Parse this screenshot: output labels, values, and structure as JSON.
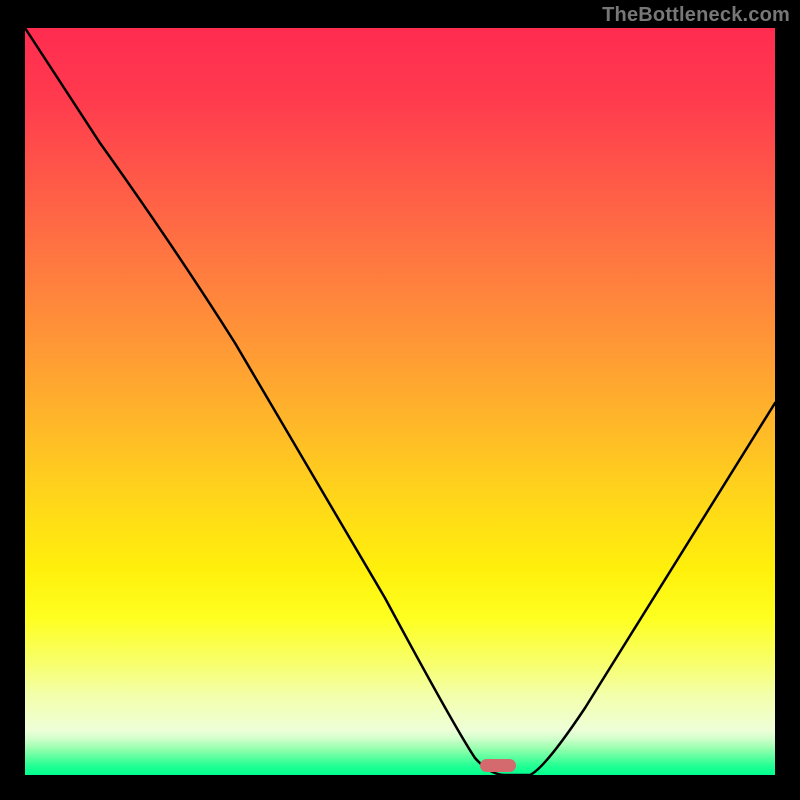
{
  "watermark": "TheBottleneck.com",
  "chart_data": {
    "type": "line",
    "title": "",
    "xlabel": "",
    "ylabel": "",
    "xlim": [
      0,
      100
    ],
    "ylim": [
      0,
      100
    ],
    "x": [
      0,
      5,
      10,
      15,
      20,
      25,
      30,
      35,
      40,
      45,
      50,
      55,
      58,
      60,
      62,
      64,
      66,
      70,
      75,
      80,
      85,
      90,
      95,
      100
    ],
    "values": [
      100,
      92,
      84,
      77,
      71,
      66,
      58,
      48,
      39,
      30,
      21,
      12,
      6,
      2,
      0,
      0,
      0,
      3,
      10,
      18,
      26,
      34,
      42,
      50
    ],
    "marker_x": 63,
    "gradient_stops": [
      {
        "pos": 0,
        "color": "#ff2c50"
      },
      {
        "pos": 46,
        "color": "#ff9a35"
      },
      {
        "pos": 77,
        "color": "#fff00c"
      },
      {
        "pos": 100,
        "color": "#00ff8e"
      }
    ]
  }
}
